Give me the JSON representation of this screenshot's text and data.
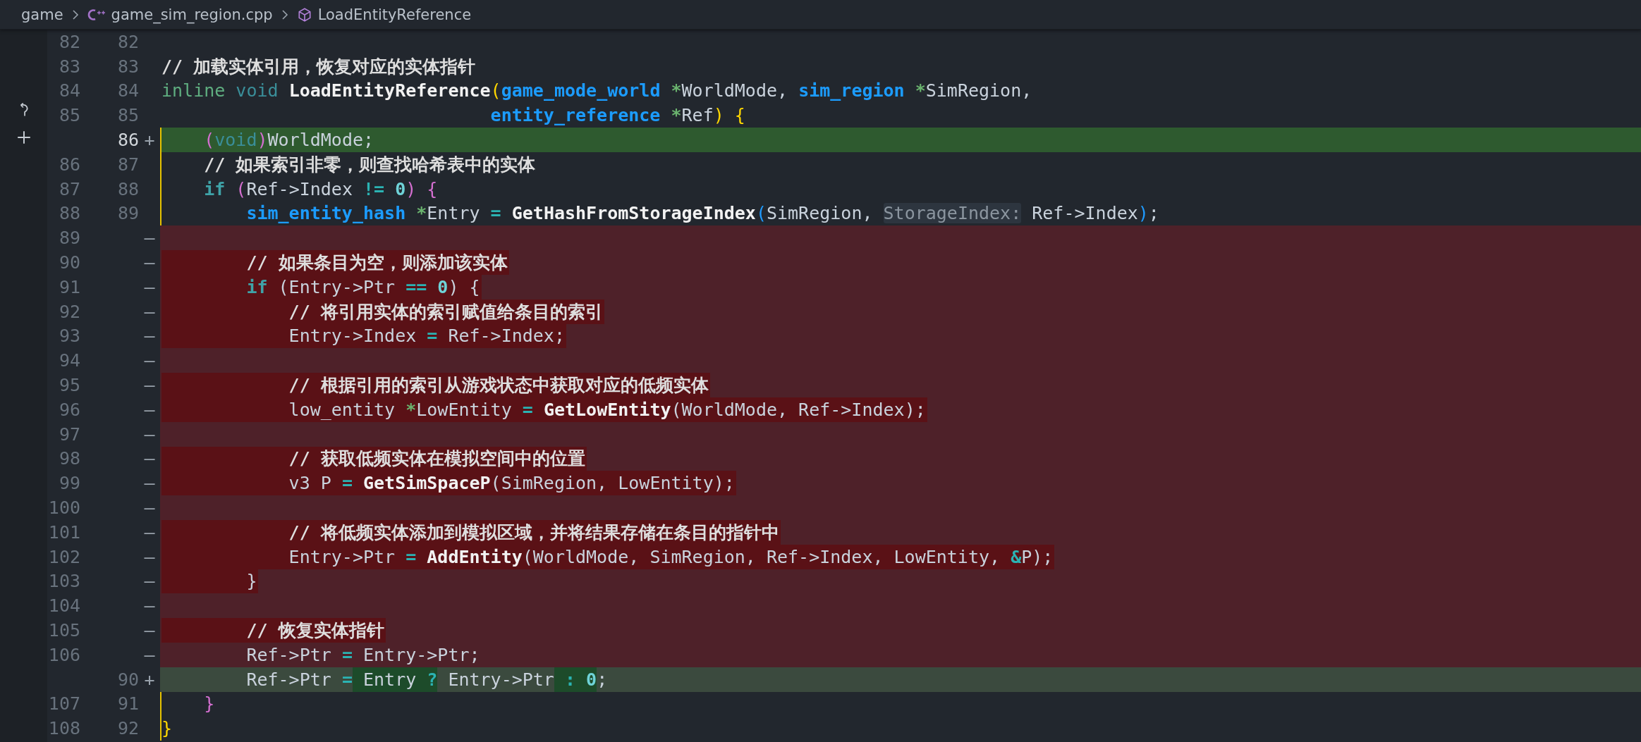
{
  "breadcrumbs": [
    {
      "text": "game",
      "kind": "folder"
    },
    {
      "text": "game_sim_region.cpp",
      "kind": "cpp-file"
    },
    {
      "text": "LoadEntityReference",
      "kind": "symbol"
    }
  ],
  "rows": [
    {
      "old": "82",
      "new": "82",
      "kind": "context"
    },
    {
      "old": "83",
      "new": "83",
      "kind": "context",
      "tokens": [
        {
          "text": "// 加载实体引用，恢复对应的实体指针",
          "kind": "comment"
        }
      ]
    },
    {
      "old": "84",
      "new": "84",
      "kind": "context",
      "tokens": [
        {
          "text": "inline",
          "kind": "storage"
        },
        {
          "text": " void",
          "kind": "kw2"
        },
        {
          "text": " LoadEntityReference",
          "kind": "fn"
        },
        {
          "text": "(",
          "kind": "b1"
        },
        {
          "text": "game_mode_world",
          "kind": "type"
        },
        {
          "text": " *",
          "kind": "ptr"
        },
        {
          "text": "WorldMode, ",
          "kind": "plain"
        },
        {
          "text": "sim_region",
          "kind": "type"
        },
        {
          "text": " *",
          "kind": "ptr"
        },
        {
          "text": "SimRegion,",
          "kind": "plain"
        }
      ]
    },
    {
      "old": "85",
      "new": "85",
      "kind": "context",
      "tokens": [
        {
          "text": "                               entity_reference",
          "kind": "type"
        },
        {
          "text": " *",
          "kind": "ptr"
        },
        {
          "text": "Ref",
          "kind": "plain"
        },
        {
          "text": ")",
          "kind": "b1"
        },
        {
          "text": " {",
          "kind": "b1"
        }
      ]
    },
    {
      "new": "86",
      "marker": "+",
      "kind": "added",
      "emphasis": true,
      "current": true,
      "guide": true,
      "tokens": [
        {
          "text": "    (",
          "kind": "b2"
        },
        {
          "text": "void",
          "kind": "kw2"
        },
        {
          "text": ")",
          "kind": "b2"
        },
        {
          "text": "WorldMode;",
          "kind": "plain"
        }
      ]
    },
    {
      "old": "86",
      "new": "87",
      "kind": "context",
      "guide": true,
      "tokens": [
        {
          "text": "    // 如果索引非零，则查找哈希表中的实体",
          "kind": "comment"
        }
      ]
    },
    {
      "old": "87",
      "new": "88",
      "kind": "context",
      "guide": true,
      "tokens": [
        {
          "text": "    if",
          "kind": "kw"
        },
        {
          "text": " (",
          "kind": "b2"
        },
        {
          "text": "Ref->Index ",
          "kind": "plain"
        },
        {
          "text": "!=",
          "kind": "op"
        },
        {
          "text": " 0",
          "kind": "num"
        },
        {
          "text": ")",
          "kind": "b2"
        },
        {
          "text": " {",
          "kind": "b2"
        }
      ]
    },
    {
      "old": "88",
      "new": "89",
      "kind": "context",
      "guide": true,
      "tokens": [
        {
          "text": "        sim_entity_hash",
          "kind": "type"
        },
        {
          "text": " *",
          "kind": "ptr"
        },
        {
          "text": "Entry ",
          "kind": "plain"
        },
        {
          "text": "=",
          "kind": "op"
        },
        {
          "text": " GetHashFromStorageIndex",
          "kind": "fn"
        },
        {
          "text": "(",
          "kind": "b3"
        },
        {
          "text": "SimRegion, ",
          "kind": "plain"
        },
        {
          "text": "StorageIndex:",
          "kind": "hint"
        },
        {
          "text": " Ref->Index",
          "kind": "plain"
        },
        {
          "text": ")",
          "kind": "b3"
        },
        {
          "text": ";",
          "kind": "plain"
        }
      ]
    },
    {
      "old": "89",
      "marker": "—",
      "kind": "removed"
    },
    {
      "old": "90",
      "marker": "—",
      "kind": "removed",
      "emphasis": true,
      "tokens": [
        {
          "text": "        // 如果条目为空，则添加该实体",
          "kind": "comment"
        }
      ]
    },
    {
      "old": "91",
      "marker": "—",
      "kind": "removed",
      "emphasis": true,
      "tokens": [
        {
          "text": "        if",
          "kind": "kw"
        },
        {
          "text": " (Entry->Ptr ",
          "kind": "plain"
        },
        {
          "text": "==",
          "kind": "op"
        },
        {
          "text": " 0",
          "kind": "num"
        },
        {
          "text": ") {",
          "kind": "plain"
        }
      ]
    },
    {
      "old": "92",
      "marker": "—",
      "kind": "removed",
      "emphasis": true,
      "tokens": [
        {
          "text": "            // 将引用实体的索引赋值给条目的索引",
          "kind": "comment"
        }
      ]
    },
    {
      "old": "93",
      "marker": "—",
      "kind": "removed",
      "emphasis": true,
      "tokens": [
        {
          "text": "            Entry->Index ",
          "kind": "plain"
        },
        {
          "text": "=",
          "kind": "op"
        },
        {
          "text": " Ref->Index;",
          "kind": "plain"
        }
      ]
    },
    {
      "old": "94",
      "marker": "—",
      "kind": "removed"
    },
    {
      "old": "95",
      "marker": "—",
      "kind": "removed",
      "emphasis": true,
      "tokens": [
        {
          "text": "            // 根据引用的索引从游戏状态中获取对应的低频实体",
          "kind": "comment"
        }
      ]
    },
    {
      "old": "96",
      "marker": "—",
      "kind": "removed",
      "emphasis": true,
      "tokens": [
        {
          "text": "            low_entity ",
          "kind": "plain"
        },
        {
          "text": "*",
          "kind": "ptr"
        },
        {
          "text": "LowEntity ",
          "kind": "plain"
        },
        {
          "text": "=",
          "kind": "op"
        },
        {
          "text": " GetLowEntity",
          "kind": "fn"
        },
        {
          "text": "(WorldMode, Ref->Index);",
          "kind": "plain"
        }
      ]
    },
    {
      "old": "97",
      "marker": "—",
      "kind": "removed"
    },
    {
      "old": "98",
      "marker": "—",
      "kind": "removed",
      "emphasis": true,
      "tokens": [
        {
          "text": "            // 获取低频实体在模拟空间中的位置",
          "kind": "comment"
        }
      ]
    },
    {
      "old": "99",
      "marker": "—",
      "kind": "removed",
      "emphasis": true,
      "tokens": [
        {
          "text": "            v3 P ",
          "kind": "plain"
        },
        {
          "text": "=",
          "kind": "op"
        },
        {
          "text": " GetSimSpaceP",
          "kind": "fn"
        },
        {
          "text": "(SimRegion, LowEntity);",
          "kind": "plain"
        }
      ]
    },
    {
      "old": "100",
      "marker": "—",
      "kind": "removed"
    },
    {
      "old": "101",
      "marker": "—",
      "kind": "removed",
      "emphasis": true,
      "tokens": [
        {
          "text": "            // 将低频实体添加到模拟区域，并将结果存储在条目的指针中",
          "kind": "comment"
        }
      ]
    },
    {
      "old": "102",
      "marker": "—",
      "kind": "removed",
      "emphasis": true,
      "tokens": [
        {
          "text": "            Entry->Ptr ",
          "kind": "plain"
        },
        {
          "text": "=",
          "kind": "op"
        },
        {
          "text": " AddEntity",
          "kind": "fn"
        },
        {
          "text": "(WorldMode, SimRegion, Ref->Index, LowEntity, ",
          "kind": "plain"
        },
        {
          "text": "&",
          "kind": "op"
        },
        {
          "text": "P);",
          "kind": "plain"
        }
      ]
    },
    {
      "old": "103",
      "marker": "—",
      "kind": "removed",
      "emphasis": true,
      "tokens": [
        {
          "text": "        }",
          "kind": "plain"
        }
      ]
    },
    {
      "old": "104",
      "marker": "—",
      "kind": "removed"
    },
    {
      "old": "105",
      "marker": "—",
      "kind": "removed",
      "emphasis": true,
      "tokens": [
        {
          "text": "        // 恢复实体指针",
          "kind": "comment"
        }
      ]
    },
    {
      "old": "106",
      "marker": "—",
      "kind": "removed",
      "emphasis": false,
      "tokens": [
        {
          "text": "        Ref->Ptr ",
          "kind": "plain"
        },
        {
          "text": "=",
          "kind": "op"
        },
        {
          "text": " Entry->Ptr;",
          "kind": "plain"
        }
      ]
    },
    {
      "new": "90",
      "marker": "+",
      "kind": "added",
      "emphasis": false,
      "current": false,
      "tokens": [
        {
          "text": "        Ref->Ptr ",
          "kind": "plain",
          "changed": false
        },
        {
          "text": "=",
          "kind": "op",
          "changed": false
        },
        {
          "text": " Entry ",
          "kind": "plain",
          "changed": true
        },
        {
          "text": "?",
          "kind": "op",
          "changed": true
        },
        {
          "text": " Entry->Ptr",
          "kind": "plain",
          "changed": false
        },
        {
          "text": " :",
          "kind": "op",
          "changed": true
        },
        {
          "text": " 0",
          "kind": "num",
          "changed": true
        },
        {
          "text": ";",
          "kind": "plain",
          "changed": false
        }
      ]
    },
    {
      "old": "107",
      "new": "91",
      "kind": "context",
      "guide": true,
      "tokens": [
        {
          "text": "    }",
          "kind": "b2"
        }
      ]
    },
    {
      "old": "108",
      "new": "92",
      "kind": "context",
      "guide": true,
      "tokens": [
        {
          "text": "}",
          "kind": "b1"
        }
      ]
    }
  ]
}
